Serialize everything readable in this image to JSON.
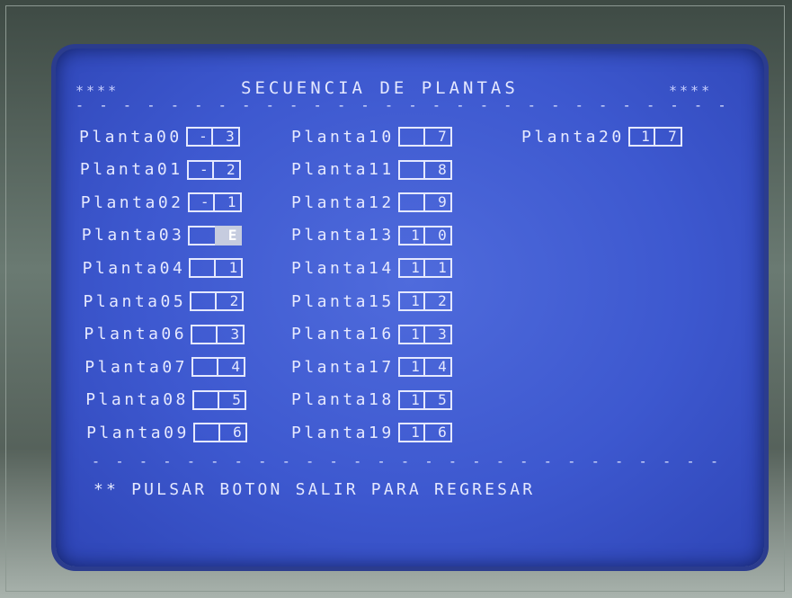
{
  "header": {
    "left_stars": "****",
    "title": "SECUENCIA DE PLANTAS",
    "right_stars": "****"
  },
  "columns": [
    {
      "rows": [
        {
          "label": "Planta00",
          "d1": "-",
          "d2": "3"
        },
        {
          "label": "Planta01",
          "d1": "-",
          "d2": "2"
        },
        {
          "label": "Planta02",
          "d1": "-",
          "d2": "1"
        },
        {
          "label": "Planta03",
          "d1": "",
          "d2": "E",
          "cursor": true
        },
        {
          "label": "Planta04",
          "d1": "",
          "d2": "1"
        },
        {
          "label": "Planta05",
          "d1": "",
          "d2": "2"
        },
        {
          "label": "Planta06",
          "d1": "",
          "d2": "3"
        },
        {
          "label": "Planta07",
          "d1": "",
          "d2": "4"
        },
        {
          "label": "Planta08",
          "d1": "",
          "d2": "5"
        },
        {
          "label": "Planta09",
          "d1": "",
          "d2": "6"
        }
      ]
    },
    {
      "rows": [
        {
          "label": "Planta10",
          "d1": "",
          "d2": "7"
        },
        {
          "label": "Planta11",
          "d1": "",
          "d2": "8"
        },
        {
          "label": "Planta12",
          "d1": "",
          "d2": "9"
        },
        {
          "label": "Planta13",
          "d1": "1",
          "d2": "0"
        },
        {
          "label": "Planta14",
          "d1": "1",
          "d2": "1"
        },
        {
          "label": "Planta15",
          "d1": "1",
          "d2": "2"
        },
        {
          "label": "Planta16",
          "d1": "1",
          "d2": "3"
        },
        {
          "label": "Planta17",
          "d1": "1",
          "d2": "4"
        },
        {
          "label": "Planta18",
          "d1": "1",
          "d2": "5"
        },
        {
          "label": "Planta19",
          "d1": "1",
          "d2": "6"
        }
      ]
    },
    {
      "rows": [
        {
          "label": "Planta20",
          "d1": "1",
          "d2": "7"
        }
      ]
    }
  ],
  "footer": {
    "message": "** PULSAR BOTON SALIR PARA REGRESAR"
  },
  "colors": {
    "screen_background": "#3d58cf",
    "text": "#e4e8ff",
    "cursor_cell": "#c6ccdf"
  }
}
